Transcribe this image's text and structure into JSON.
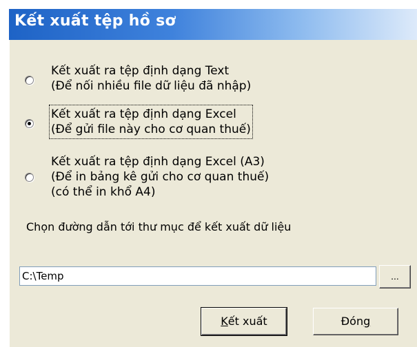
{
  "window": {
    "title": "Kết xuất tệp hồ sơ"
  },
  "options": [
    {
      "line1": "Kết xuất ra tệp định dạng Text",
      "line2": "(Để nối nhiều file dữ liệu đã nhập)",
      "line3": "",
      "checked": false
    },
    {
      "line1": "Kết xuất ra tệp định dạng Excel",
      "line2": "(Để gửi file này cho cơ quan thuế)",
      "line3": "",
      "checked": true
    },
    {
      "line1": "Kết xuất ra tệp định dạng Excel (A3)",
      "line2": "(Để in bảng kê gửi cho cơ quan thuế)",
      "line3": "(có thể in khổ A4)",
      "checked": false
    }
  ],
  "path": {
    "caption": "Chọn đường dẫn tới thư mục để kết xuất dữ liệu",
    "value": "C:\\Temp",
    "browse_label": "..."
  },
  "buttons": {
    "export_mnemonic": "K",
    "export_rest": "ết xuất",
    "close_pre": "Đón",
    "close_mnemonic": "g"
  }
}
